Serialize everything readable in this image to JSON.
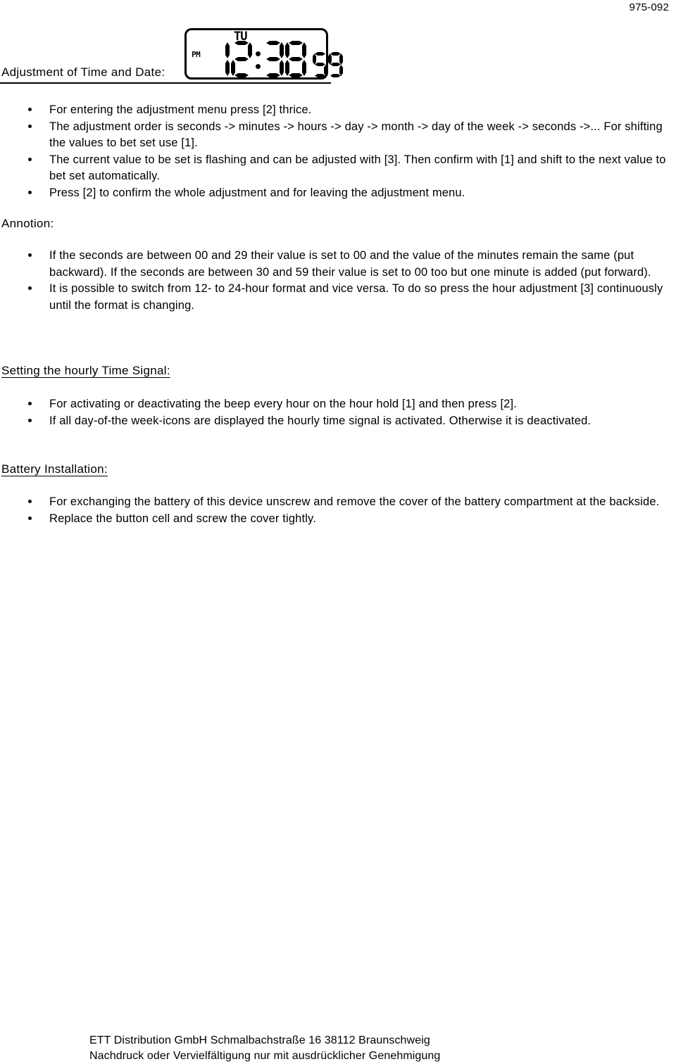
{
  "document": {
    "page_number": "975-092"
  },
  "lcd": {
    "weekday": "TU",
    "meridiem": "PM",
    "hours": "12",
    "minutes": "38",
    "seconds": "59",
    "separator": ":"
  },
  "sections": {
    "adjustment": {
      "heading": "Adjustment of Time and Date:",
      "bullets": [
        "For entering the adjustment menu press [2] thrice.",
        "The adjustment order is seconds -> minutes -> hours -> day -> month -> day of the week -> seconds ->... For shifting the values to bet set use [1].",
        "The current value to be set is flashing and can be adjusted with [3]. Then confirm with [1] and shift to the next value to bet set automatically.",
        "Press [2] to confirm the whole adjustment and for leaving the adjustment menu."
      ]
    },
    "annotion": {
      "label": "Annotion:",
      "bullets": [
        "If the seconds are between 00 and 29 their value is set to 00 and the value of the minutes remain the same (put backward). If the seconds are between 30 and 59 their value is set to 00 too but one minute is added (put forward).",
        "It is possible to switch from 12- to 24-hour format and vice versa. To do so press the hour adjustment [3] continuously until the format is changing."
      ]
    },
    "hourly_signal": {
      "heading": "Setting the hourly Time Signal:",
      "bullets": [
        "For activating or deactivating the beep every hour on the hour hold [1] and then press [2].",
        "If all day-of-the week-icons are displayed the hourly time signal is activated. Otherwise it is deactivated."
      ]
    },
    "battery": {
      "heading": "Battery Installation:",
      "bullets": [
        "For exchanging the battery of this device unscrew and remove the cover of the battery compartment at the backside.",
        "Replace the button cell and screw the cover tightly."
      ]
    }
  },
  "footer": {
    "line1": "ETT Distribution GmbH Schmalbachstraße 16 38112 Braunschweig",
    "line2": "Nachdruck oder Vervielfältigung nur mit ausdrücklicher Genehmigung"
  }
}
